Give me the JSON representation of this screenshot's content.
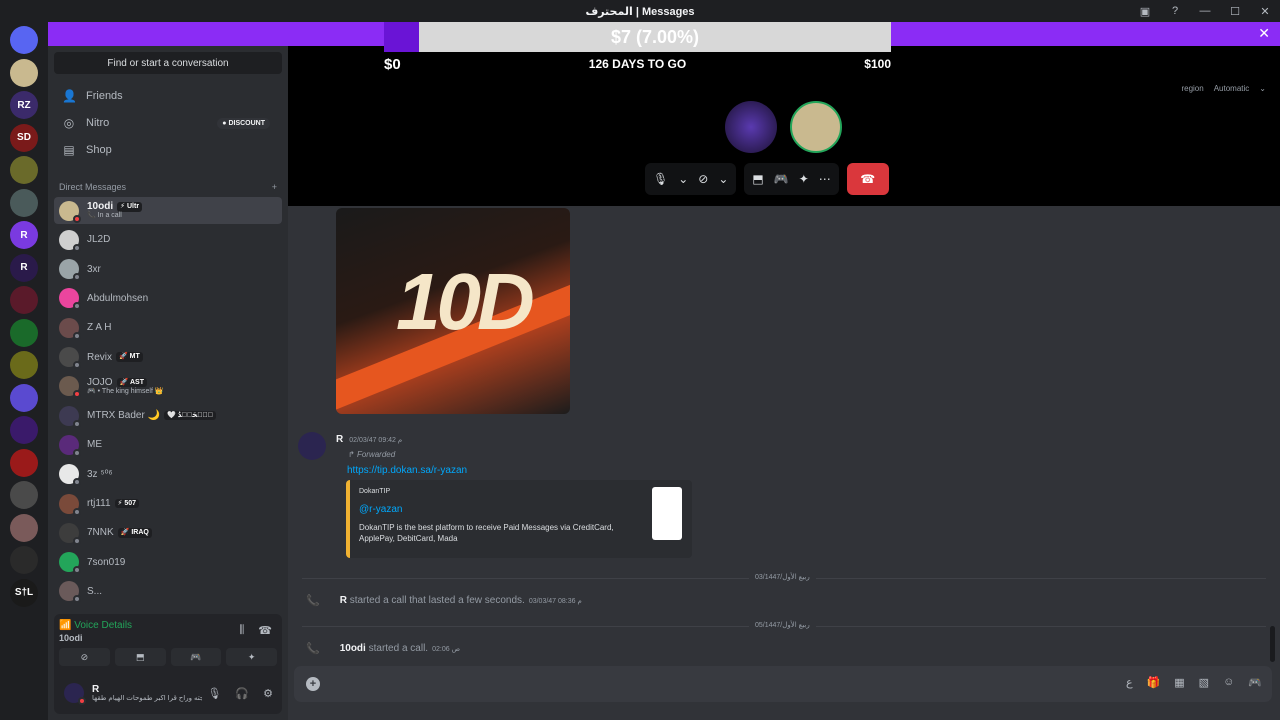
{
  "window": {
    "title": "المحترف | Messages"
  },
  "banner": {
    "progress_text": "$7 (7.00%)",
    "min": "$0",
    "days": "126 DAYS TO GO",
    "max": "$100",
    "progress_fraction": 0.07
  },
  "call": {
    "region_label": "region",
    "region_value": "Automatic"
  },
  "sidebar": {
    "find": "Find or start a conversation",
    "nav": [
      {
        "label": "Friends",
        "icon": "friends-icon"
      },
      {
        "label": "Nitro",
        "icon": "nitro-icon",
        "badge": "DISCOUNT"
      },
      {
        "label": "Shop",
        "icon": "shop-icon"
      }
    ],
    "dm_header": "Direct Messages",
    "dms": [
      {
        "name": "10odi",
        "tag": "⚡ Ultr",
        "sub": "📞 In a call",
        "color": "#c9b98f",
        "status": "dnd"
      },
      {
        "name": "JL2D",
        "tag": "",
        "sub": "",
        "color": "#cfcfcf",
        "status": "off"
      },
      {
        "name": "3xr",
        "tag": "",
        "sub": "",
        "color": "#9aa4a8",
        "status": "off"
      },
      {
        "name": "Abdulmohsen",
        "tag": "",
        "sub": "",
        "color": "#eb459e",
        "status": "off"
      },
      {
        "name": "Z A H",
        "tag": "",
        "sub": "",
        "color": "#6b4b4b",
        "status": "off"
      },
      {
        "name": "Revix",
        "tag": "🚀 MT",
        "sub": "",
        "color": "#4a4a4a",
        "status": "off"
      },
      {
        "name": "JOJO",
        "tag": "🚀 AST",
        "sub": "🎮 • The king himself 👑",
        "color": "#6b5a4e",
        "status": "dnd"
      },
      {
        "name": "MTRX Bader 🌙",
        "tag": "🤍 ٱلۡحَمۡدُ",
        "sub": "",
        "color": "#3d3a52",
        "status": "off"
      },
      {
        "name": "ME",
        "tag": "",
        "sub": "",
        "color": "#5a2a7a",
        "status": "off"
      },
      {
        "name": "3z ⁵⁰⁶",
        "tag": "",
        "sub": "",
        "color": "#e8e8e8",
        "status": "off"
      },
      {
        "name": "rtj111",
        "tag": "⚡ 507",
        "sub": "",
        "color": "#7a4a3a",
        "status": "off"
      },
      {
        "name": "7NNK",
        "tag": "🚀 IRAQ",
        "sub": "",
        "color": "#3d3d3d",
        "status": "off"
      },
      {
        "name": "7son019",
        "tag": "",
        "sub": "",
        "color": "#23a55a",
        "status": "off"
      },
      {
        "name": "S...",
        "tag": "",
        "sub": "",
        "color": "#6a5a5a",
        "status": "off"
      }
    ]
  },
  "voice": {
    "details": "Voice Details",
    "channel": "10odi"
  },
  "user": {
    "name": "R",
    "status": "من لقد حاجته وراح قرا اكبر طموحات الهيام طقها ..."
  },
  "chat": {
    "image_logo": "10D",
    "message": {
      "author": "R",
      "time": "02/03/47 09:42 م",
      "forwarded": "Forwarded",
      "link": "https://tip.dokan.sa/r-yazan",
      "embed_provider": "DokanTIP",
      "embed_title": "@r-yazan",
      "embed_desc": "DokanTIP is the best platform to receive Paid Messages via CreditCard, ApplePay, DebitCard, Mada"
    },
    "divider1": "03/1447/ربيع الأول",
    "sys1": {
      "author": "R",
      "text": "started a call that lasted a few seconds.",
      "time": "03/03/47 08:36 م"
    },
    "divider2": "05/1447/ربيع الأول",
    "sys2": {
      "author": "10odi",
      "text": "started a call.",
      "time": "02:06 ص"
    }
  },
  "servers": [
    {
      "label": "",
      "color": "#5865f2"
    },
    {
      "label": "",
      "color": "#c9b98f"
    },
    {
      "label": "RZ",
      "color": "#3b2a6a"
    },
    {
      "label": "SD",
      "color": "#7a1a1a"
    },
    {
      "label": "",
      "color": "#6a6a2a"
    },
    {
      "label": "",
      "color": "#4a5a5a"
    },
    {
      "label": "R",
      "color": "#7a3ae0"
    },
    {
      "label": "R",
      "color": "#2a1a4a"
    },
    {
      "label": "",
      "color": "#5a1a2a"
    },
    {
      "label": "",
      "color": "#1a6a2a"
    },
    {
      "label": "",
      "color": "#6a6a1a"
    },
    {
      "label": "",
      "color": "#5a4ad0"
    },
    {
      "label": "",
      "color": "#3a1a6a"
    },
    {
      "label": "",
      "color": "#9a1a1a"
    },
    {
      "label": "",
      "color": "#4a4a4a"
    },
    {
      "label": "",
      "color": "#7a5a5a"
    },
    {
      "label": "",
      "color": "#2a2a2a"
    },
    {
      "label": "S†L",
      "color": "#1a1a1a"
    }
  ]
}
